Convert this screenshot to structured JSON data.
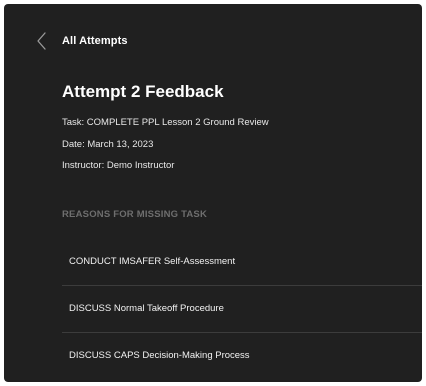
{
  "nav": {
    "back_label": "All Attempts"
  },
  "feedback": {
    "title": "Attempt 2 Feedback",
    "task": "Task: COMPLETE PPL Lesson 2 Ground Review",
    "date": "Date: March 13, 2023",
    "instructor": "Instructor: Demo Instructor"
  },
  "reasons": {
    "header": "REASONS FOR MISSING TASK",
    "items": [
      {
        "label": "CONDUCT IMSAFER Self-Assessment"
      },
      {
        "label": "DISCUSS Normal Takeoff Procedure"
      },
      {
        "label": "DISCUSS CAPS Decision-Making Process"
      }
    ]
  },
  "colors": {
    "background": "#202020",
    "text": "#ffffff",
    "section_header": "#6e6e6e",
    "divider": "#3c3c3c"
  },
  "icons": {
    "back": "chevron-left-icon"
  }
}
